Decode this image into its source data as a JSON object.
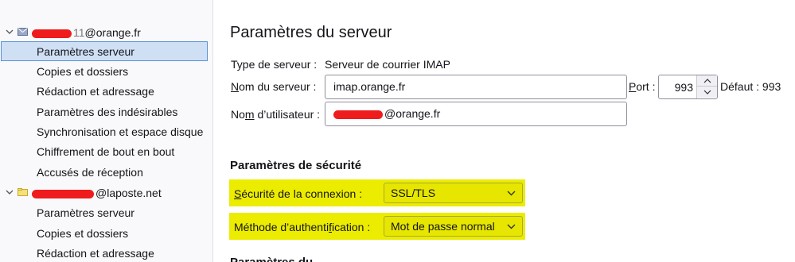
{
  "sidebar": {
    "accounts": [
      {
        "name_suffix": "@orange.fr",
        "icon": "mail-envelope-icon",
        "items": [
          {
            "label": "Paramètres serveur"
          },
          {
            "label": "Copies et dossiers"
          },
          {
            "label": "Rédaction et adressage"
          },
          {
            "label": "Paramètres des indésirables"
          },
          {
            "label": "Synchronisation et espace disque"
          },
          {
            "label": "Chiffrement de bout en bout"
          },
          {
            "label": "Accusés de réception"
          }
        ]
      },
      {
        "name_suffix": "@laposte.net",
        "icon": "mail-folder-icon",
        "items": [
          {
            "label": "Paramètres serveur"
          },
          {
            "label": "Copies et dossiers"
          },
          {
            "label": "Rédaction et adressage"
          }
        ]
      }
    ]
  },
  "main": {
    "title": "Paramètres du serveur",
    "server_type_label": "Type de serveur :",
    "server_type_value": "Serveur de courrier IMAP",
    "server_name_label_pre": "",
    "server_name_label_u": "N",
    "server_name_label_post": "om du serveur :",
    "server_name_value": "imap.orange.fr",
    "port_label_u": "P",
    "port_label_post": "ort :",
    "port_value": "993",
    "port_default": "Défaut : 993",
    "username_label_pre": "No",
    "username_label_u": "m",
    "username_label_post": " d’utilisateur :",
    "username_suffix": "@orange.fr",
    "security_title": "Paramètres de sécurité",
    "conn_security_label_u": "S",
    "conn_security_label_post": "écurité de la connexion :",
    "conn_security_value": "SSL/TLS",
    "auth_label_pre": "Méthode d’authenti",
    "auth_label_u": "f",
    "auth_label_post": "ication :",
    "auth_value": "Mot de passe normal",
    "next_section_partial": "Paramètres du..."
  },
  "colors": {
    "highlight": "#ecec00",
    "redaction": "#ee1c1c",
    "selected_bg": "#cfe0f5",
    "selected_border": "#5b8fd4"
  }
}
